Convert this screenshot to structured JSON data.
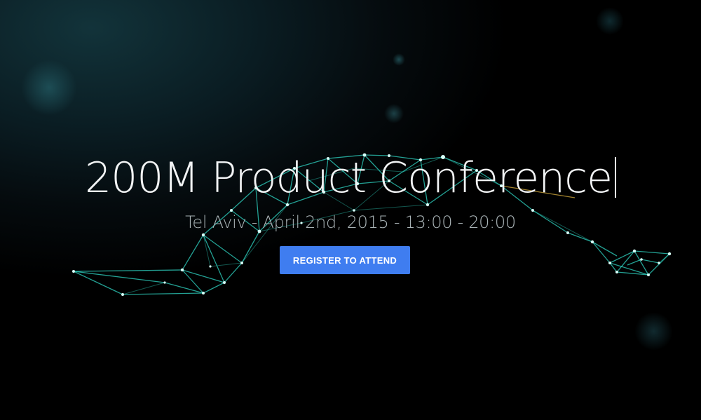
{
  "hero": {
    "title": "200M Product Conference",
    "subtitle": "Tel Aviv - April 2nd, 2015 - 13:00 - 20:00",
    "register_label": "REGISTER TO ATTEND"
  },
  "colors": {
    "button": "#3f7df0",
    "network": "#2fd6c4",
    "background": "#000000"
  }
}
